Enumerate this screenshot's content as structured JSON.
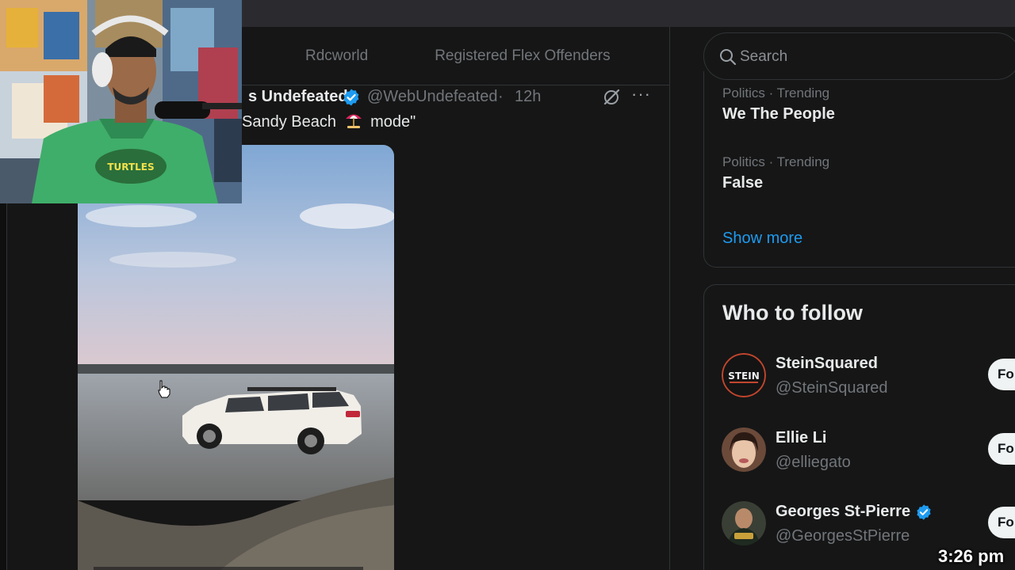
{
  "header": {
    "tabs": [
      "Rdcworld",
      "Registered Flex Offenders"
    ]
  },
  "tweet": {
    "author_partial": "s Undefeated",
    "handle": "@WebUndefeated",
    "separator": "·",
    "time": "12h",
    "more": "···",
    "text_before": "Sandy Beach",
    "text_after": "mode\""
  },
  "search": {
    "placeholder": "Search"
  },
  "trends": {
    "items": [
      {
        "meta": "Politics · Trending",
        "name": "We The People"
      },
      {
        "meta": "Politics · Trending",
        "name": "False"
      }
    ],
    "show_more": "Show more"
  },
  "who_to_follow": {
    "title": "Who to follow",
    "button_label": "Fo",
    "people": [
      {
        "name": "SteinSquared",
        "handle": "@SteinSquared",
        "avatar_text": "STEIN",
        "verified": false
      },
      {
        "name": "Ellie Li",
        "handle": "@elliegato",
        "verified": false
      },
      {
        "name": "Georges St-Pierre",
        "handle": "@GeorgesStPierre",
        "verified": true
      }
    ]
  },
  "overlay": {
    "clock": "3:26 pm",
    "shirt_text": "TURTLES"
  },
  "colors": {
    "accent": "#1d9bf0",
    "background": "#161616",
    "border": "#2f3336",
    "muted_text": "#71767b"
  }
}
